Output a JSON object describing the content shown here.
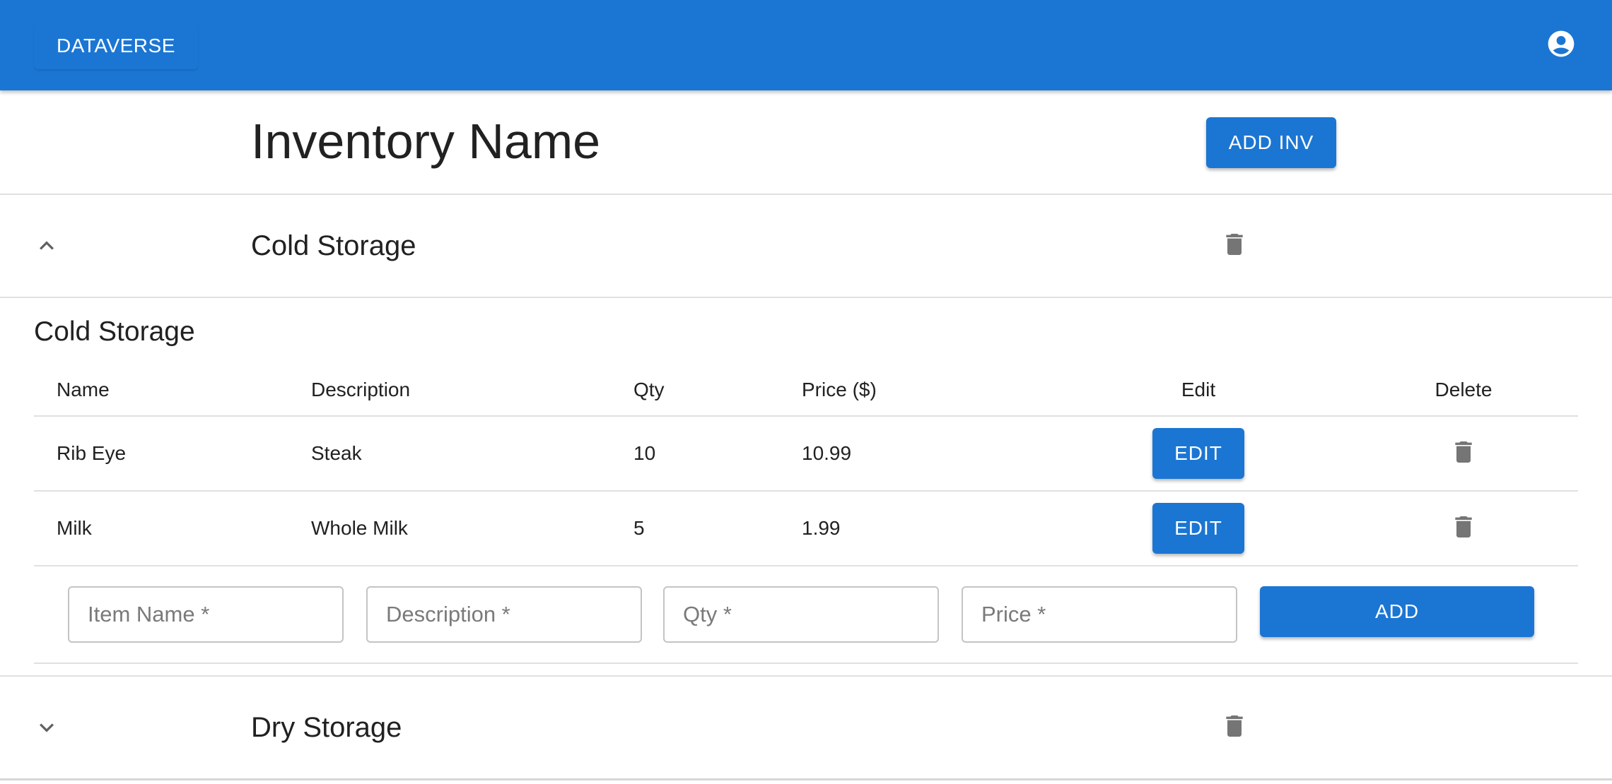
{
  "appbar": {
    "brand": "DATAVERSE",
    "account_icon": "account-circle-icon"
  },
  "header": {
    "title": "Inventory Name",
    "add_inv_label": "ADD INV"
  },
  "sections": [
    {
      "title": "Cold Storage",
      "expanded": true,
      "chevron_icon": "chevron-up-icon",
      "delete_icon": "trash-icon",
      "panel_title": "Cold Storage",
      "columns": [
        "Name",
        "Description",
        "Qty",
        "Price ($)",
        "Edit",
        "Delete"
      ],
      "rows": [
        {
          "name": "Rib Eye",
          "description": "Steak",
          "qty": "10",
          "price": "10.99",
          "edit_label": "EDIT"
        },
        {
          "name": "Milk",
          "description": "Whole Milk",
          "qty": "5",
          "price": "1.99",
          "edit_label": "EDIT"
        }
      ],
      "form": {
        "item_name_placeholder": "Item Name *",
        "description_placeholder": "Description *",
        "qty_placeholder": "Qty *",
        "price_placeholder": "Price *",
        "add_label": "ADD"
      }
    },
    {
      "title": "Dry Storage",
      "expanded": false,
      "chevron_icon": "chevron-down-icon",
      "delete_icon": "trash-icon"
    }
  ],
  "colors": {
    "primary": "#1b76d3",
    "icon_grey": "#757575",
    "divider": "#e0e0e0"
  }
}
